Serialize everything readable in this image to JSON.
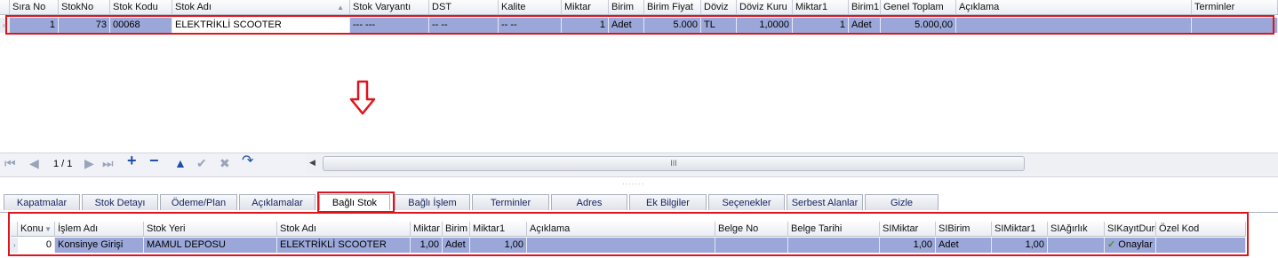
{
  "top_grid": {
    "columns": [
      "Sıra No",
      "StokNo",
      "Stok Kodu",
      "Stok Adı",
      "Stok Varyantı",
      "DST",
      "Kalite",
      "Miktar",
      "Birim",
      "Birim Fiyat",
      "Döviz",
      "Döviz Kuru",
      "Miktar1",
      "Birim1",
      "Genel Toplam",
      "Açıklama",
      "Terminler"
    ],
    "row": {
      "sira_no": "1",
      "stok_no": "73",
      "stok_kodu": "00068",
      "stok_adi": "ELEKTRİKLİ SCOOTER",
      "stok_varyanti": "--- ---",
      "dst": "-- --",
      "kalite": "-- --",
      "miktar": "1",
      "birim": "Adet",
      "birim_fiyat": "5.000",
      "doviz": "TL",
      "doviz_kuru": "1,0000",
      "miktar1": "1",
      "birim1": "Adet",
      "genel_toplam": "5.000,00",
      "aciklama": "",
      "terminler": ""
    },
    "sort_icon": "sort-ascending-icon",
    "row_indicator_icon": "row-indicator-icon"
  },
  "arrow_icon": "down-arrow-icon",
  "navigator": {
    "page": "1 / 1",
    "buttons": [
      "first",
      "prev",
      "next",
      "next-page",
      "last",
      "append",
      "remove",
      "edit",
      "end-edit",
      "cancel-edit",
      "refresh"
    ],
    "scroll_grip": "III"
  },
  "tabs": [
    "Kapatmalar",
    "Stok Detayı",
    "Ödeme/Plan",
    "Açıklamalar",
    "Bağlı Stok",
    "Bağlı İşlem",
    "Terminler",
    "Adres",
    "Ek Bilgiler",
    "Seçenekler",
    "Serbest Alanlar",
    "Gizle"
  ],
  "active_tab": "Bağlı Stok",
  "bottom_grid": {
    "columns": [
      "Konu",
      "İşlem Adı",
      "Stok Yeri",
      "Stok Adı",
      "Miktar",
      "Birim",
      "Miktar1",
      "Açıklama",
      "Belge No",
      "Belge Tarihi",
      "SIMiktar",
      "SIBirim",
      "SIMiktar1",
      "SIAğırlık",
      "SIKayıtDuru",
      "Özel Kod"
    ],
    "row": {
      "konu": "0",
      "islem_adi": "Konsinye Girişi",
      "stok_yeri": "MAMUL DEPOSU",
      "stok_adi": "ELEKTRİKLİ SCOOTER",
      "miktar": "1,00",
      "birim": "Adet",
      "miktar1": "1,00",
      "aciklama": "",
      "belge_no": "",
      "belge_tarihi": "",
      "si_miktar": "1,00",
      "si_birim": "Adet",
      "si_miktar1": "1,00",
      "si_agirlik": "",
      "si_kayit_durumu": "Onaylar",
      "ozel_kod": ""
    },
    "filter_icon": "filter-icon",
    "status_icon": "checkmark-icon"
  },
  "colors": {
    "highlight": "#e0141c",
    "selection": "#9aa7d8",
    "accent": "#1e4fa8"
  }
}
